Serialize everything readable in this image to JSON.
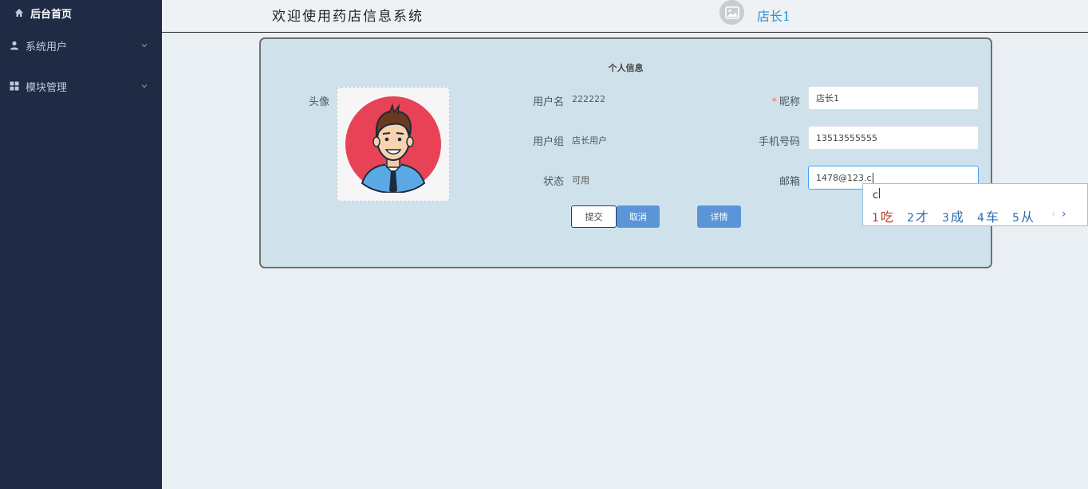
{
  "sidebar": {
    "items": [
      {
        "label": "后台首页",
        "icon": "home-icon"
      },
      {
        "label": "系统用户",
        "icon": "user-icon"
      },
      {
        "label": "模块管理",
        "icon": "grid-icon"
      }
    ]
  },
  "header": {
    "welcome": "欢迎使用药店信息系统",
    "username": "店长1",
    "avatar_icon": "image-icon"
  },
  "card": {
    "title": "个人信息",
    "avatar_label": "头像",
    "username_label": "用户名",
    "username_value": "222222",
    "group_label": "用户组",
    "group_value": "店长用户",
    "status_label": "状态",
    "status_value": "可用",
    "nickname_required": "*",
    "nickname_label": "昵称",
    "nickname_value": "店长1",
    "phone_label": "手机号码",
    "phone_value": "13513555555",
    "email_label": "邮箱",
    "email_value": "1478@123.c",
    "buttons": {
      "submit": "提交",
      "cancel": "取消",
      "detail": "详情"
    }
  },
  "ime": {
    "composition": "c",
    "candidates": [
      {
        "num": "1",
        "text": "吃"
      },
      {
        "num": "2",
        "text": "才"
      },
      {
        "num": "3",
        "text": "成"
      },
      {
        "num": "4",
        "text": "车"
      },
      {
        "num": "5",
        "text": "从"
      }
    ],
    "prev": "‹",
    "next": "›"
  },
  "colors": {
    "sidebar_bg": "#1f2a44",
    "card_bg": "#cfe2ec",
    "primary": "#5b95d8",
    "link": "#2b8fd6"
  }
}
